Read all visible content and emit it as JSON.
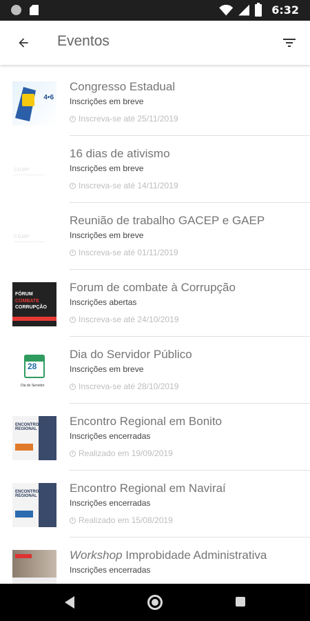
{
  "status_bar": {
    "time": "6:32"
  },
  "app_bar": {
    "title": "Eventos"
  },
  "events": [
    {
      "title": "Congresso Estadual",
      "title_em": "",
      "status": "Inscrições em breve",
      "date_text": "Inscreva-se até 25/11/2019",
      "thumb": "congresso"
    },
    {
      "title": "16 dias de ativismo",
      "title_em": "",
      "status": "Inscrições em breve",
      "date_text": "Inscreva-se até 14/11/2019",
      "thumb": "logo"
    },
    {
      "title": "Reunião de trabalho GACEP e GAEP",
      "title_em": "",
      "status": "Inscrições em breve",
      "date_text": "Inscreva-se até 01/11/2019",
      "thumb": "logo"
    },
    {
      "title": "Forum de combate à Corrupção",
      "title_em": "",
      "status": "Inscrições abertas",
      "date_text": "Inscreva-se até 24/10/2019",
      "thumb": "forum"
    },
    {
      "title": "Dia do Servidor Público",
      "title_em": "",
      "status": "Inscrições em breve",
      "date_text": "Inscreva-se até 28/10/2019",
      "thumb": "servidor"
    },
    {
      "title": "Encontro Regional em Bonito",
      "title_em": "",
      "status": "Inscrições encerradas",
      "date_text": "Realizado em 19/09/2019",
      "thumb": "bonito"
    },
    {
      "title": "Encontro Regional em Naviraí",
      "title_em": "",
      "status": "Inscrições encerradas",
      "date_text": "Realizado em 15/08/2019",
      "thumb": "navirai"
    },
    {
      "title": "Improbidade Administrativa",
      "title_em": "Workshop",
      "status": "Inscrições encerradas",
      "date_text": "",
      "thumb": "workshop"
    }
  ],
  "icons": {
    "back": "arrow-left-icon",
    "filter": "filter-icon",
    "clock": "clock-icon"
  },
  "colors": {
    "title_text": "#757575",
    "status_text": "#424242",
    "date_text": "#bdbdbd",
    "divider": "#e0e0e0"
  }
}
